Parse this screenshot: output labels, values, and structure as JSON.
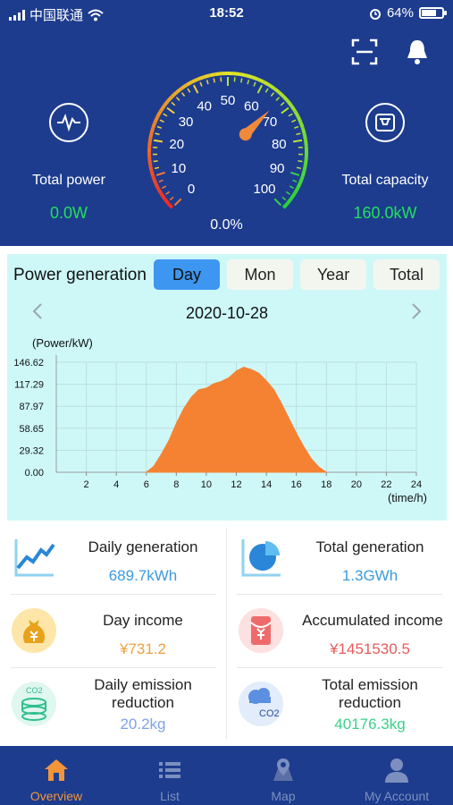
{
  "status_bar": {
    "carrier": "中国联通",
    "time": "18:52",
    "battery": "64%"
  },
  "header": {
    "total_power_label": "Total power",
    "total_power_value": "0.0W",
    "total_capacity_label": "Total capacity",
    "total_capacity_value": "160.0kW",
    "gauge_percent": "0.0%",
    "gauge_ticks": [
      "0",
      "10",
      "20",
      "30",
      "40",
      "50",
      "60",
      "70",
      "80",
      "90",
      "100"
    ],
    "gauge_value": 0,
    "icons": [
      "scan-icon",
      "bell-icon",
      "power-wave-icon",
      "capacity-icon"
    ]
  },
  "card": {
    "title": "Power generation",
    "tabs": [
      {
        "label": "Day",
        "active": true
      },
      {
        "label": "Mon",
        "active": false
      },
      {
        "label": "Year",
        "active": false
      },
      {
        "label": "Total",
        "active": false
      }
    ],
    "date": "2020-10-28",
    "accent": "#f58232",
    "background": "#cef8f8"
  },
  "chart_data": {
    "type": "area",
    "ylabel": "(Power/kW)",
    "xlabel": "(time/h)",
    "y_ticks": [
      "146.62",
      "117.29",
      "87.97",
      "58.65",
      "29.32",
      "0.00"
    ],
    "x_ticks": [
      "2",
      "4",
      "6",
      "8",
      "10",
      "12",
      "14",
      "16",
      "18",
      "20",
      "22",
      "24"
    ],
    "xlim": [
      0,
      24
    ],
    "ylim": [
      0,
      146.62
    ],
    "x": [
      6.0,
      6.5,
      7.0,
      7.5,
      8.0,
      8.5,
      9.0,
      9.5,
      10.0,
      10.5,
      11.0,
      11.5,
      12.0,
      12.5,
      13.0,
      13.5,
      14.0,
      14.5,
      15.0,
      15.5,
      16.0,
      16.5,
      17.0,
      17.5,
      18.0
    ],
    "y": [
      0,
      8,
      24,
      42,
      65,
      85,
      100,
      110,
      112,
      118,
      121,
      126,
      135,
      140,
      137,
      132,
      122,
      110,
      92,
      72,
      52,
      34,
      18,
      7,
      0
    ],
    "series": [
      {
        "values": [
          0,
          8,
          24,
          42,
          65,
          85,
          100,
          110,
          112,
          118,
          121,
          126,
          135,
          140,
          137,
          132,
          122,
          110,
          92,
          72,
          52,
          34,
          18,
          7,
          0
        ]
      }
    ],
    "grid": true
  },
  "stats": {
    "daily_generation": {
      "label": "Daily generation",
      "value": "689.7kWh",
      "color": "#3a9be0"
    },
    "total_generation": {
      "label": "Total generation",
      "value": "1.3GWh",
      "color": "#3a9be0"
    },
    "day_income": {
      "label": "Day income",
      "value": "¥731.2",
      "color": "#f0a040"
    },
    "accumulated_income": {
      "label": "Accumulated income",
      "value": "¥1451530.5",
      "color": "#e85a5a"
    },
    "daily_emission": {
      "label_line1": "Daily emission",
      "label_line2": "reduction",
      "value": "20.2kg",
      "color": "#7da3e8"
    },
    "total_emission": {
      "label_line1": "Total emission",
      "label_line2": "reduction",
      "value": "40176.3kg",
      "color": "#3ad08a"
    }
  },
  "bottom_nav": [
    {
      "label": "Overview",
      "active": true
    },
    {
      "label": "List",
      "active": false
    },
    {
      "label": "Map",
      "active": false
    },
    {
      "label": "My Account",
      "active": false
    }
  ]
}
